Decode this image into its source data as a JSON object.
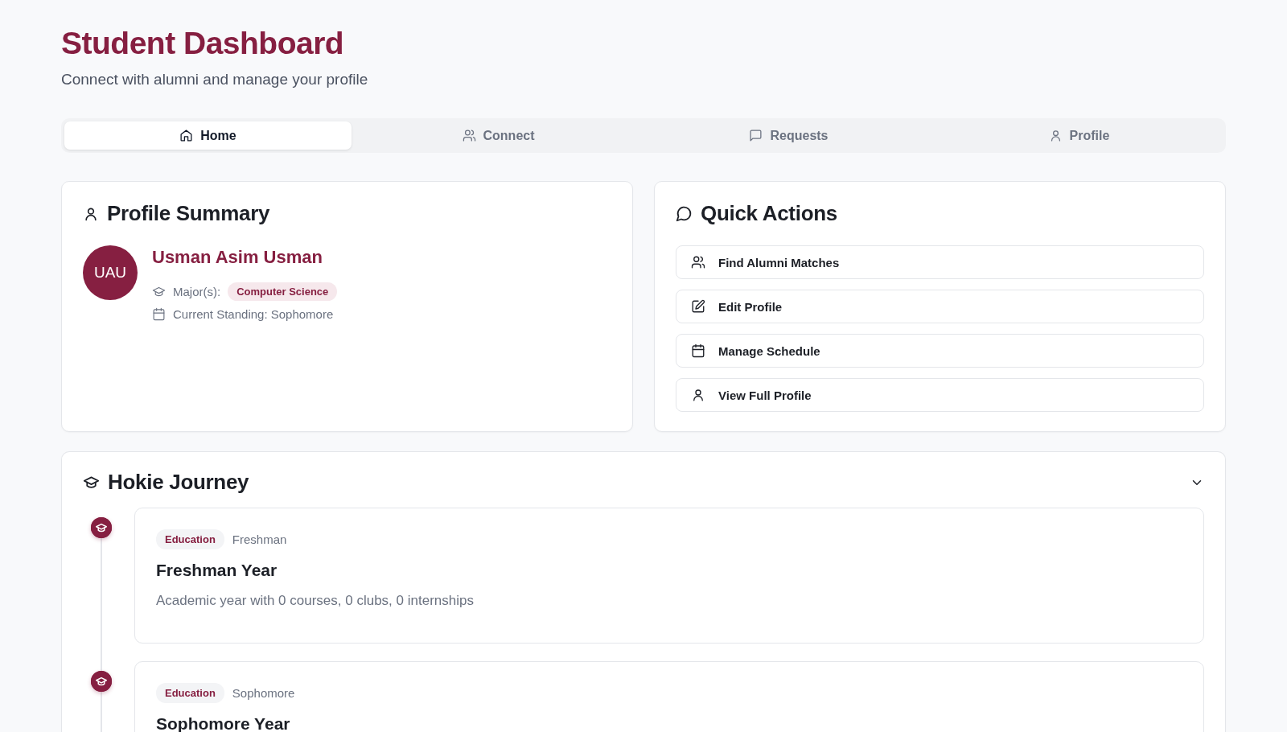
{
  "header": {
    "title": "Student Dashboard",
    "subtitle": "Connect with alumni and manage your profile"
  },
  "tabs": [
    {
      "label": "Home",
      "selected": true
    },
    {
      "label": "Connect",
      "selected": false
    },
    {
      "label": "Requests",
      "selected": false
    },
    {
      "label": "Profile",
      "selected": false
    }
  ],
  "profile_summary": {
    "title": "Profile Summary",
    "initials": "UAU",
    "name": "Usman Asim Usman",
    "majors_label": "Major(s):",
    "majors": [
      "Computer Science"
    ],
    "standing": "Current Standing: Sophomore"
  },
  "quick_actions": {
    "title": "Quick Actions",
    "actions": [
      "Find Alumni Matches",
      "Edit Profile",
      "Manage Schedule",
      "View Full Profile"
    ]
  },
  "journey": {
    "title": "Hokie Journey",
    "expanded": true,
    "entries": [
      {
        "tag": "Education",
        "period": "Freshman",
        "title": "Freshman Year",
        "description": "Academic year with 0 courses, 0 clubs, 0 internships"
      },
      {
        "tag": "Education",
        "period": "Sophomore",
        "title": "Sophomore Year"
      }
    ]
  }
}
